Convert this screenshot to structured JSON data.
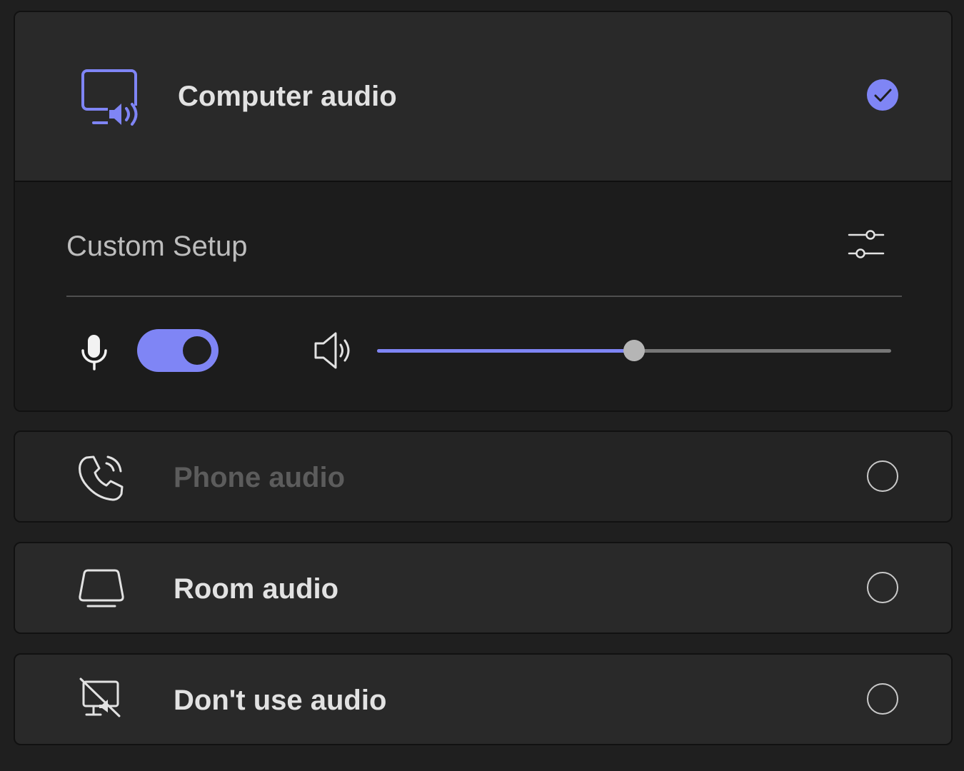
{
  "options": {
    "computer": {
      "label": "Computer audio",
      "icon": "computer-audio-icon",
      "selected": true,
      "custom_setup": {
        "title": "Custom Setup",
        "settings_icon": "sliders-settings-icon",
        "mic_icon": "microphone-icon",
        "mic_enabled": true,
        "speaker_icon": "speaker-icon",
        "speaker_volume": 0.5
      }
    },
    "phone": {
      "label": "Phone audio",
      "icon": "phone-audio-icon",
      "selected": false,
      "disabled": true
    },
    "room": {
      "label": "Room audio",
      "icon": "room-audio-icon",
      "selected": false
    },
    "none": {
      "label": "Don't use audio",
      "icon": "no-audio-icon",
      "selected": false
    }
  },
  "colors": {
    "accent": "#7f85f5",
    "background": "#1f1f1f",
    "card": "#292929",
    "text": "#e2e2e2",
    "disabled_text": "#5c5c5c"
  }
}
